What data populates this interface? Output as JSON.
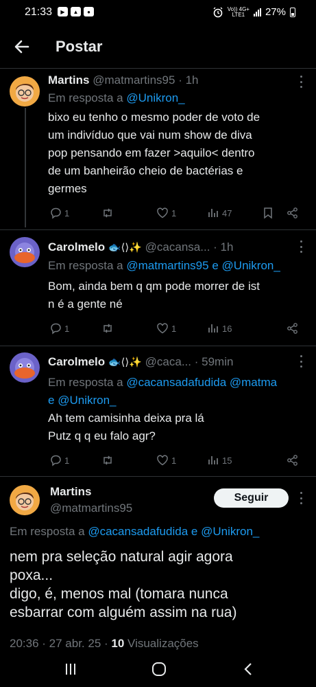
{
  "status_bar": {
    "time": "21:33",
    "volte": "Vo)) 4G+",
    "lte": "LTE1",
    "battery": "27%"
  },
  "header": {
    "title": "Postar"
  },
  "tweets": [
    {
      "name": "Martins",
      "handle": "@matmartins95",
      "time": "· 1h",
      "reply_prefix": "Em resposta a",
      "reply_links": [
        "@Unikron_"
      ],
      "text": "bixo eu tenho o mesmo poder de voto de\num indivíduo que vai num show de diva\npop pensando em fazer >aquilo< dentro\nde um banheirão cheio de bactérias e\ngermes",
      "replies": "1",
      "retweets": "",
      "likes": "1",
      "views": "47"
    },
    {
      "name": "Carolmelo",
      "emoji": "🐟⟨⟩✨",
      "handle": "@cacansa...",
      "time": "· 1h",
      "reply_prefix": "Em resposta a",
      "reply_links": [
        "@matmartins95",
        "@Unikron_"
      ],
      "reply_joiner": "e",
      "text": "Bom, ainda bem q qm pode morrer de ist\nn é a gente né",
      "replies": "1",
      "retweets": "",
      "likes": "1",
      "views": "16"
    },
    {
      "name": "Carolmelo",
      "emoji": "🐟⟨⟩✨",
      "handle": "@caca...",
      "time": "· 59min",
      "reply_prefix": "Em resposta a",
      "reply_links": [
        "@cacansadafudida",
        "@matma",
        "@Unikron_"
      ],
      "reply_joiner": "e",
      "text": "Ah tem camisinha deixa pra lá\nPutz q q eu falo agr?",
      "replies": "1",
      "retweets": "",
      "likes": "1",
      "views": "15"
    }
  ],
  "main_tweet": {
    "name": "Martins",
    "handle": "@matmartins95",
    "follow_label": "Seguir",
    "reply_prefix": "Em resposta a",
    "reply_links": [
      "@cacansadafudida",
      "@Unikron_"
    ],
    "reply_joiner": "e",
    "text": "nem pra seleção natural agir agora\npoxa...\ndigo, é, menos mal (tomara nunca\nesbarrar com alguém assim na rua)",
    "timestamp": "20:36 · 27 abr. 25 ·",
    "views_count": "10",
    "views_label": "Visualizações"
  },
  "colors": {
    "background": "#000000",
    "text": "#e7e9ea",
    "muted": "#71767b",
    "link": "#1d9bf0",
    "follow_bg": "#eff3f4"
  },
  "icons": [
    "back-arrow-icon",
    "more-icon",
    "reply-icon",
    "retweet-icon",
    "like-icon",
    "views-icon",
    "bookmark-icon",
    "share-icon",
    "recents-icon",
    "home-icon",
    "back-nav-icon"
  ]
}
